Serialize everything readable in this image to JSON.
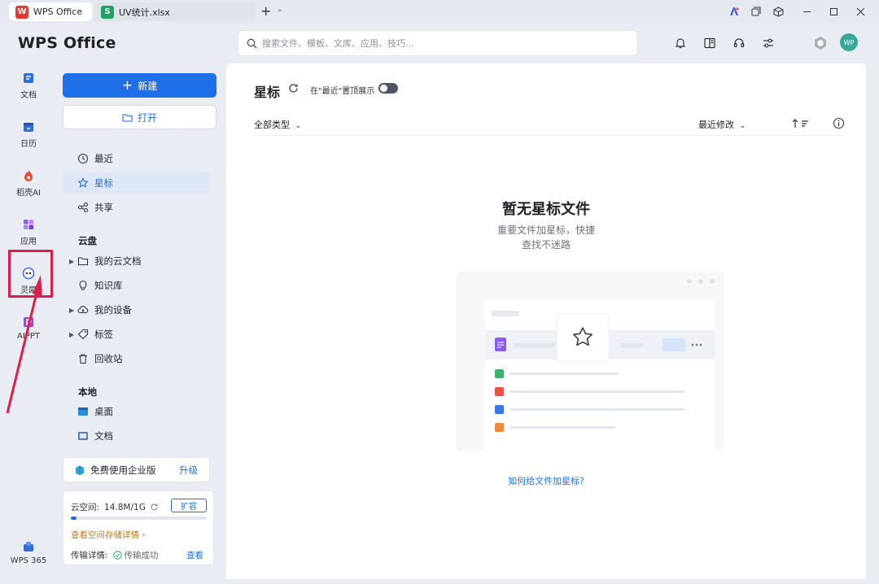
{
  "tabs": [
    {
      "label": "WPS Office",
      "icon": "wps-logo-icon",
      "color": "#e33b32"
    },
    {
      "label": "UV统计.xlsx",
      "icon": "spreadsheet-icon",
      "color": "#1ea362"
    }
  ],
  "header": {
    "app_title": "WPS Office",
    "search_placeholder": "搜索文件、模板、文库、应用、技巧...",
    "avatar_text": "WP"
  },
  "rail": {
    "items": [
      {
        "label": "文档",
        "icon": "document-icon"
      },
      {
        "label": "日历",
        "icon": "calendar-icon"
      },
      {
        "label": "稻壳AI",
        "icon": "ai-flame-icon"
      },
      {
        "label": "应用",
        "icon": "apps-grid-icon"
      },
      {
        "label": "灵犀",
        "icon": "lingxi-icon"
      },
      {
        "label": "AIPPT",
        "icon": "aippt-icon"
      },
      {
        "label": "WPS 365",
        "icon": "wps365-icon"
      }
    ],
    "annotation": {
      "highlight_color": "#d8204a"
    }
  },
  "nav": {
    "new_label": "新建",
    "open_label": "打开",
    "quick": [
      {
        "label": "最近",
        "icon": "clock-icon"
      },
      {
        "label": "星标",
        "icon": "star-icon"
      },
      {
        "label": "共享",
        "icon": "share-icon"
      }
    ],
    "cloud_section": "云盘",
    "cloud": [
      {
        "label": "我的云文档",
        "icon": "folder-icon"
      },
      {
        "label": "知识库",
        "icon": "lightbulb-icon"
      },
      {
        "label": "我的设备",
        "icon": "cloud-device-icon"
      },
      {
        "label": "标签",
        "icon": "tag-icon"
      },
      {
        "label": "回收站",
        "icon": "trash-icon"
      }
    ],
    "local_section": "本地",
    "local": [
      {
        "label": "桌面",
        "icon": "desktop-icon"
      },
      {
        "label": "文档",
        "icon": "documents-folder-icon"
      }
    ],
    "upgrade": {
      "label": "免费使用企业版",
      "action": "升级"
    },
    "storage": {
      "label": "云空间:",
      "value": "14.8M/1G",
      "expand": "扩容",
      "used_fraction": 0.04,
      "details_link": "查看空间存储详情 ›",
      "transfer_label": "传输详情:",
      "transfer_status": "传输成功",
      "view": "查看"
    }
  },
  "main": {
    "title": "星标",
    "pin_label": "在\"最近\"置顶展示",
    "filter_label": "全部类型",
    "sort_label": "最近修改",
    "empty_title": "暂无星标文件",
    "empty_line1": "重要文件加星标，快捷",
    "empty_line2": "查找不迷路",
    "help_link": "如何给文件加星标?"
  },
  "colors": {
    "accent": "#1e6fe8",
    "background": "#e9edf3",
    "annotation": "#d8204a"
  }
}
